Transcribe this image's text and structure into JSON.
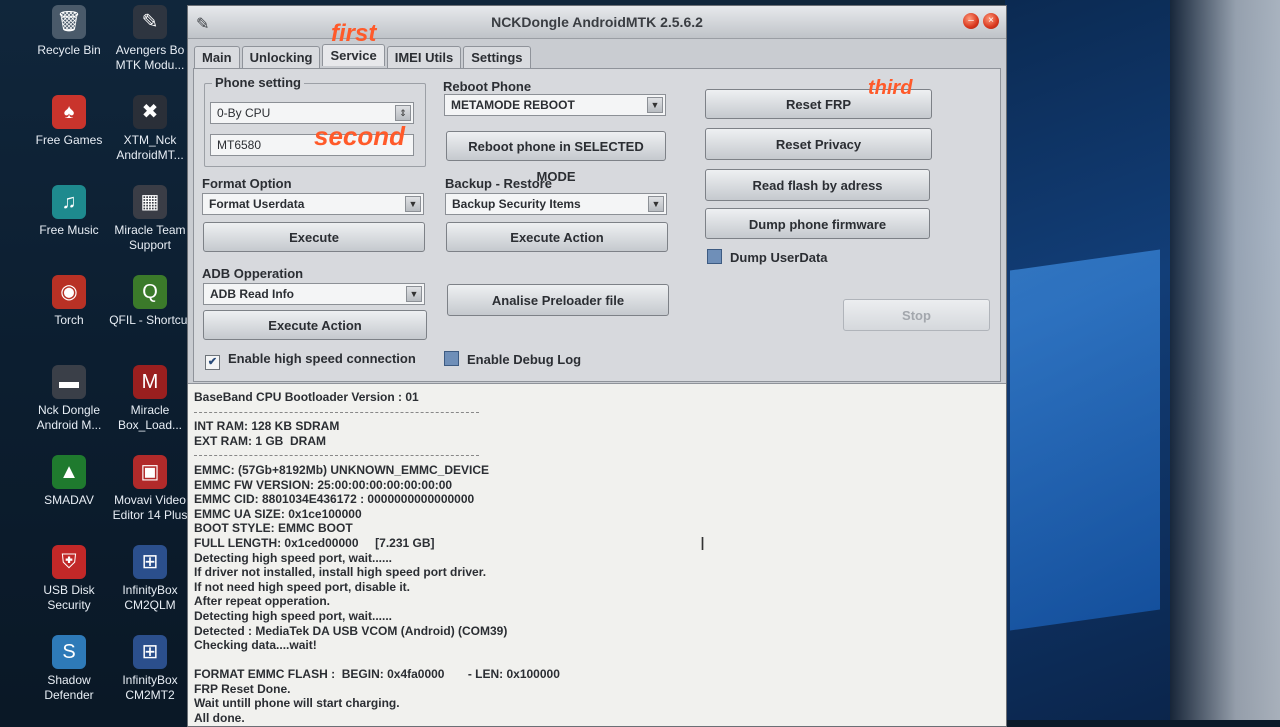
{
  "desktop": {
    "icons": [
      {
        "label": "Recycle Bin",
        "glyph": "🗑",
        "color": "#4a5a6a"
      },
      {
        "label": "Avengers Bo MTK Modu...",
        "glyph": "✎",
        "color": "#2e3540"
      },
      {
        "label": "Free Games",
        "glyph": "♠",
        "color": "#c9342c"
      },
      {
        "label": "XTM_Nck AndroidMT...",
        "glyph": "✖",
        "color": "#2a2f38"
      },
      {
        "label": "Free Music",
        "glyph": "♫",
        "color": "#1e8a8e"
      },
      {
        "label": "Miracle Team Support",
        "glyph": "▦",
        "color": "#3a3d46"
      },
      {
        "label": "Torch",
        "glyph": "◉",
        "color": "#b83125"
      },
      {
        "label": "QFIL - Shortcut",
        "glyph": "Q",
        "color": "#3b7a2a"
      },
      {
        "label": "Nck Dongle Android M...",
        "glyph": "▬",
        "color": "#3a3f48"
      },
      {
        "label": "Miracle Box_Load...",
        "glyph": "M",
        "color": "#9a1f1f"
      },
      {
        "label": "SMADAV",
        "glyph": "▲",
        "color": "#1f7a2e"
      },
      {
        "label": "Movavi Video Editor 14 Plus",
        "glyph": "▣",
        "color": "#b12a2a"
      },
      {
        "label": "USB Disk Security",
        "glyph": "⛨",
        "color": "#c22828"
      },
      {
        "label": "InfinityBox CM2QLM",
        "glyph": "⊞",
        "color": "#2b4f8c"
      },
      {
        "label": "Shadow Defender",
        "glyph": "S",
        "color": "#2e7ab8"
      },
      {
        "label": "InfinityBox CM2MT2",
        "glyph": "⊞",
        "color": "#2b4f8c"
      }
    ]
  },
  "window": {
    "title": "NCKDongle AndroidMTK 2.5.6.2",
    "tabs": [
      "Main",
      "Unlocking",
      "Service",
      "IMEI Utils",
      "Settings"
    ],
    "active_tab": "Service",
    "phone_setting": {
      "label": "Phone setting",
      "cpu_combo": "0-By CPU",
      "model_combo": "MT6580"
    },
    "reboot_phone": {
      "label": "Reboot Phone",
      "mode_combo": "METAMODE REBOOT",
      "reboot_button": "Reboot phone in SELECTED MODE"
    },
    "format_option": {
      "label": "Format Option",
      "combo": "Format Userdata",
      "execute_button": "Execute"
    },
    "backup_restore": {
      "label": "Backup - Restore",
      "combo": "Backup Security Items",
      "execute_button": "Execute Action"
    },
    "adb": {
      "label": "ADB Opperation",
      "combo": "ADB Read Info",
      "execute_button": "Execute Action",
      "analise_button": "Analise Preloader file"
    },
    "right_buttons": {
      "reset_frp": "Reset FRP",
      "reset_privacy": "Reset Privacy",
      "read_flash": "Read flash by adress",
      "dump_firmware": "Dump phone firmware",
      "dump_userdata": "Dump UserData",
      "stop": "Stop"
    },
    "checks": {
      "high_speed": "Enable high speed connection",
      "debug_log": "Enable Debug Log"
    },
    "annotations": {
      "first": "first",
      "second": "second",
      "third": "third"
    },
    "log": [
      "BaseBand CPU Bootloader Version : 01",
      "---",
      "INT RAM: 128 KB SDRAM",
      "EXT RAM: 1 GB  DRAM",
      "---",
      "EMMC: (57Gb+8192Mb) UNKNOWN_EMMC_DEVICE",
      "EMMC FW VERSION: 25:00:00:00:00:00:00:00",
      "EMMC CID: 8801034E436172 : 0000000000000000",
      "EMMC UA SIZE: 0x1ce100000",
      "BOOT STYLE: EMMC BOOT",
      "FULL LENGTH: 0x1ced00000     [7.231 GB]",
      "Detecting high speed port, wait......",
      "If driver not installed, install high speed port driver.",
      "If not need high speed port, disable it.",
      "After repeat opperation.",
      "Detecting high speed port, wait......",
      "Detected : MediaTek DA USB VCOM (Android) (COM39)",
      "Checking data....wait!",
      "",
      "FORMAT EMMC FLASH :  BEGIN: 0x4fa0000       - LEN: 0x100000",
      "FRP Reset Done.",
      "Wait untill phone will start charging.",
      "All done."
    ]
  }
}
